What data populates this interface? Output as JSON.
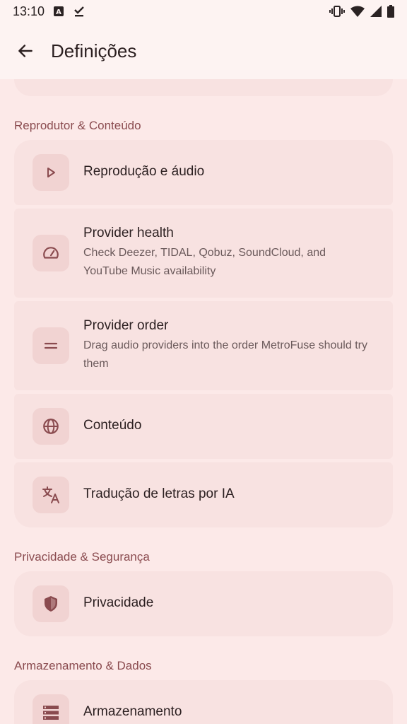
{
  "status_bar": {
    "time": "13:10"
  },
  "header": {
    "title": "Definições"
  },
  "sections": [
    {
      "title": "Reprodutor & Conteúdo",
      "items": [
        {
          "title": "Reprodução e áudio",
          "icon": "play-icon"
        },
        {
          "title": "Provider health",
          "subtitle": "Check Deezer, TIDAL, Qobuz, SoundCloud, and YouTube Music availability",
          "icon": "speedometer-icon"
        },
        {
          "title": "Provider order",
          "subtitle": "Drag audio providers into the order MetroFuse should try them",
          "icon": "drag-handle-icon"
        },
        {
          "title": "Conteúdo",
          "icon": "globe-icon"
        },
        {
          "title": "Tradução de letras por IA",
          "icon": "translate-icon"
        }
      ]
    },
    {
      "title": "Privacidade & Segurança",
      "items": [
        {
          "title": "Privacidade",
          "icon": "shield-icon"
        }
      ]
    },
    {
      "title": "Armazenamento & Dados",
      "items": [
        {
          "title": "Armazenamento",
          "icon": "storage-icon"
        }
      ]
    }
  ],
  "colors": {
    "background": "#fce9e8",
    "card": "#f8e2e1",
    "icon_box": "#f1d3d2",
    "accent": "#8a4b4f"
  }
}
